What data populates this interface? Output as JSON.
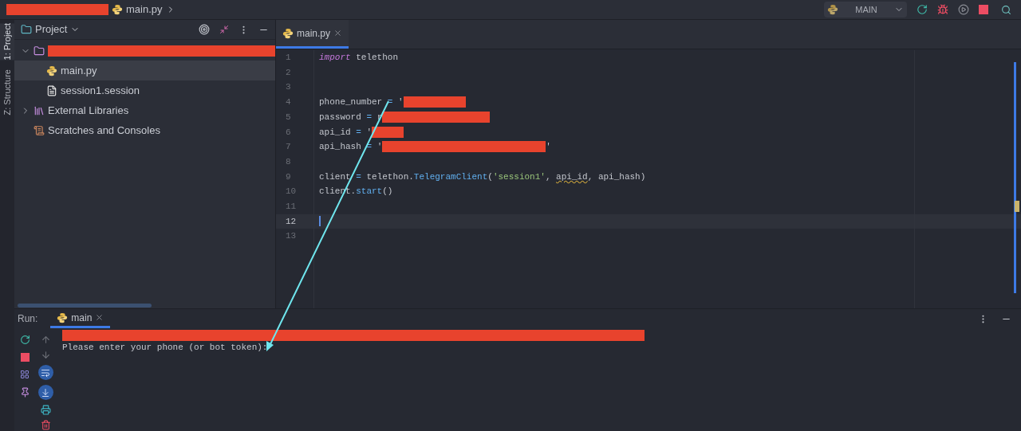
{
  "breadcrumb": {
    "segments": [
      {
        "kind": "redacted"
      },
      {
        "kind": "python",
        "label": "main.py"
      }
    ]
  },
  "run_config": {
    "label": "MAIN"
  },
  "side_tabs": [
    {
      "label": "1: Project",
      "selected": true
    },
    {
      "label": "Z: Structure",
      "selected": false
    }
  ],
  "project": {
    "title": "Project",
    "tree": [
      {
        "kind": "redacted",
        "expanded": true,
        "children": [
          {
            "kind": "python",
            "label": "main.py",
            "selected": true
          },
          {
            "kind": "file",
            "label": "session1.session",
            "selected": false
          }
        ]
      },
      {
        "kind": "library",
        "label": "External Libraries",
        "expanded": false
      },
      {
        "kind": "scratches",
        "label": "Scratches and Consoles"
      }
    ]
  },
  "editor": {
    "tabs": [
      {
        "label": "main.py",
        "selected": true
      }
    ],
    "lines": [
      {
        "number": "1",
        "selected": false,
        "segments": [
          {
            "kind": "keyword",
            "text": "import"
          },
          {
            "kind": "plain",
            "text": " telethon"
          }
        ]
      },
      {
        "number": "2",
        "selected": false
      },
      {
        "number": "3",
        "selected": false
      },
      {
        "number": "4",
        "selected": false,
        "segments": [
          {
            "kind": "plain",
            "text": "phone_number "
          },
          {
            "kind": "operator",
            "text": "="
          },
          {
            "kind": "plain",
            "text": " '"
          },
          {
            "kind": "redacted"
          }
        ]
      },
      {
        "number": "5",
        "selected": false,
        "segments": [
          {
            "kind": "plain",
            "text": "password "
          },
          {
            "kind": "operator",
            "text": "="
          },
          {
            "kind": "plain",
            "text": " r"
          },
          {
            "kind": "redacted"
          }
        ]
      },
      {
        "number": "6",
        "selected": false,
        "segments": [
          {
            "kind": "plain",
            "text": "api_id "
          },
          {
            "kind": "operator",
            "text": "="
          },
          {
            "kind": "plain",
            "text": " '"
          },
          {
            "kind": "redacted"
          }
        ]
      },
      {
        "number": "7",
        "selected": false,
        "segments": [
          {
            "kind": "plain",
            "text": "api_hash "
          },
          {
            "kind": "operator",
            "text": "="
          },
          {
            "kind": "plain",
            "text": " '"
          },
          {
            "kind": "redacted"
          },
          {
            "kind": "plain",
            "text": "'"
          }
        ]
      },
      {
        "number": "8",
        "selected": false
      },
      {
        "number": "9",
        "selected": false,
        "segments": [
          {
            "kind": "plain",
            "text": "client "
          },
          {
            "kind": "operator",
            "text": "="
          },
          {
            "kind": "plain",
            "text": " telethon."
          },
          {
            "kind": "function",
            "text": "TelegramClient"
          },
          {
            "kind": "plain",
            "text": "("
          },
          {
            "kind": "string",
            "text": "'session1'"
          },
          {
            "kind": "plain",
            "text": ", "
          },
          {
            "kind": "warning",
            "text": "api_id"
          },
          {
            "kind": "plain",
            "text": ", api_hash)"
          }
        ]
      },
      {
        "number": "10",
        "selected": false,
        "segments": [
          {
            "kind": "plain",
            "text": "client."
          },
          {
            "kind": "function",
            "text": "start"
          },
          {
            "kind": "plain",
            "text": "()"
          }
        ]
      },
      {
        "number": "11",
        "selected": false
      },
      {
        "number": "12",
        "selected": true
      },
      {
        "number": "13",
        "selected": false
      }
    ]
  },
  "run": {
    "label": "Run:",
    "tabs": [
      {
        "label": "main",
        "selected": true
      }
    ],
    "output": [
      {
        "kind": "redacted"
      },
      {
        "kind": "text",
        "text": "Please enter your phone (or bot token):"
      }
    ]
  }
}
